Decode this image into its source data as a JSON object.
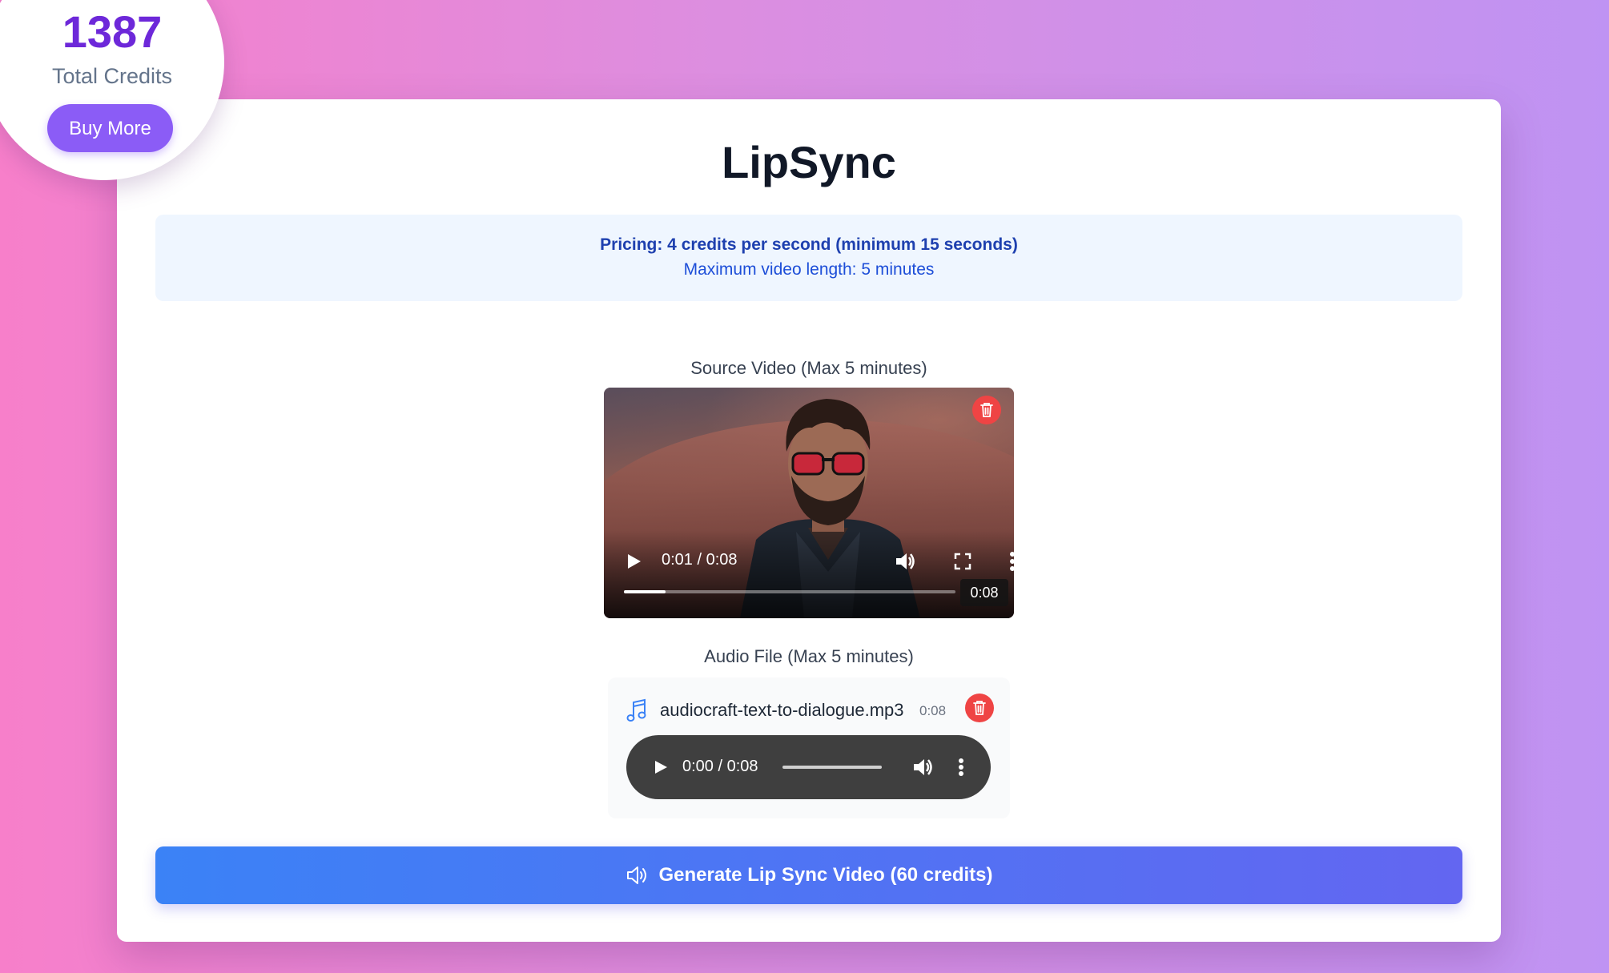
{
  "credits": {
    "total": "1387",
    "label": "Total Credits",
    "buy_label": "Buy More"
  },
  "page": {
    "title": "LipSync"
  },
  "pricing": {
    "line": "Pricing: 4 credits per second (minimum 15 seconds)",
    "max_length": "Maximum video length: 5 minutes"
  },
  "source_video": {
    "label": "Source Video (Max 5 minutes)",
    "time_display": "0:01 / 0:08",
    "duration_chip": "0:08",
    "progress": 0.125
  },
  "audio": {
    "label": "Audio File (Max 5 minutes)",
    "filename": "audiocraft-text-to-dialogue.mp3",
    "duration": "0:08",
    "time_display": "0:00 / 0:08",
    "progress": 0
  },
  "generate": {
    "label": "Generate Lip Sync Video (60 credits)"
  },
  "colors": {
    "accent": "#8b5cf6",
    "credits_number": "#6d28d9",
    "delete": "#ef4444",
    "generate_start": "#3b82f6",
    "generate_end": "#6366f1"
  },
  "icons": {
    "delete": "trash-icon",
    "audio": "music-note-icon",
    "generate": "speaker-icon"
  }
}
